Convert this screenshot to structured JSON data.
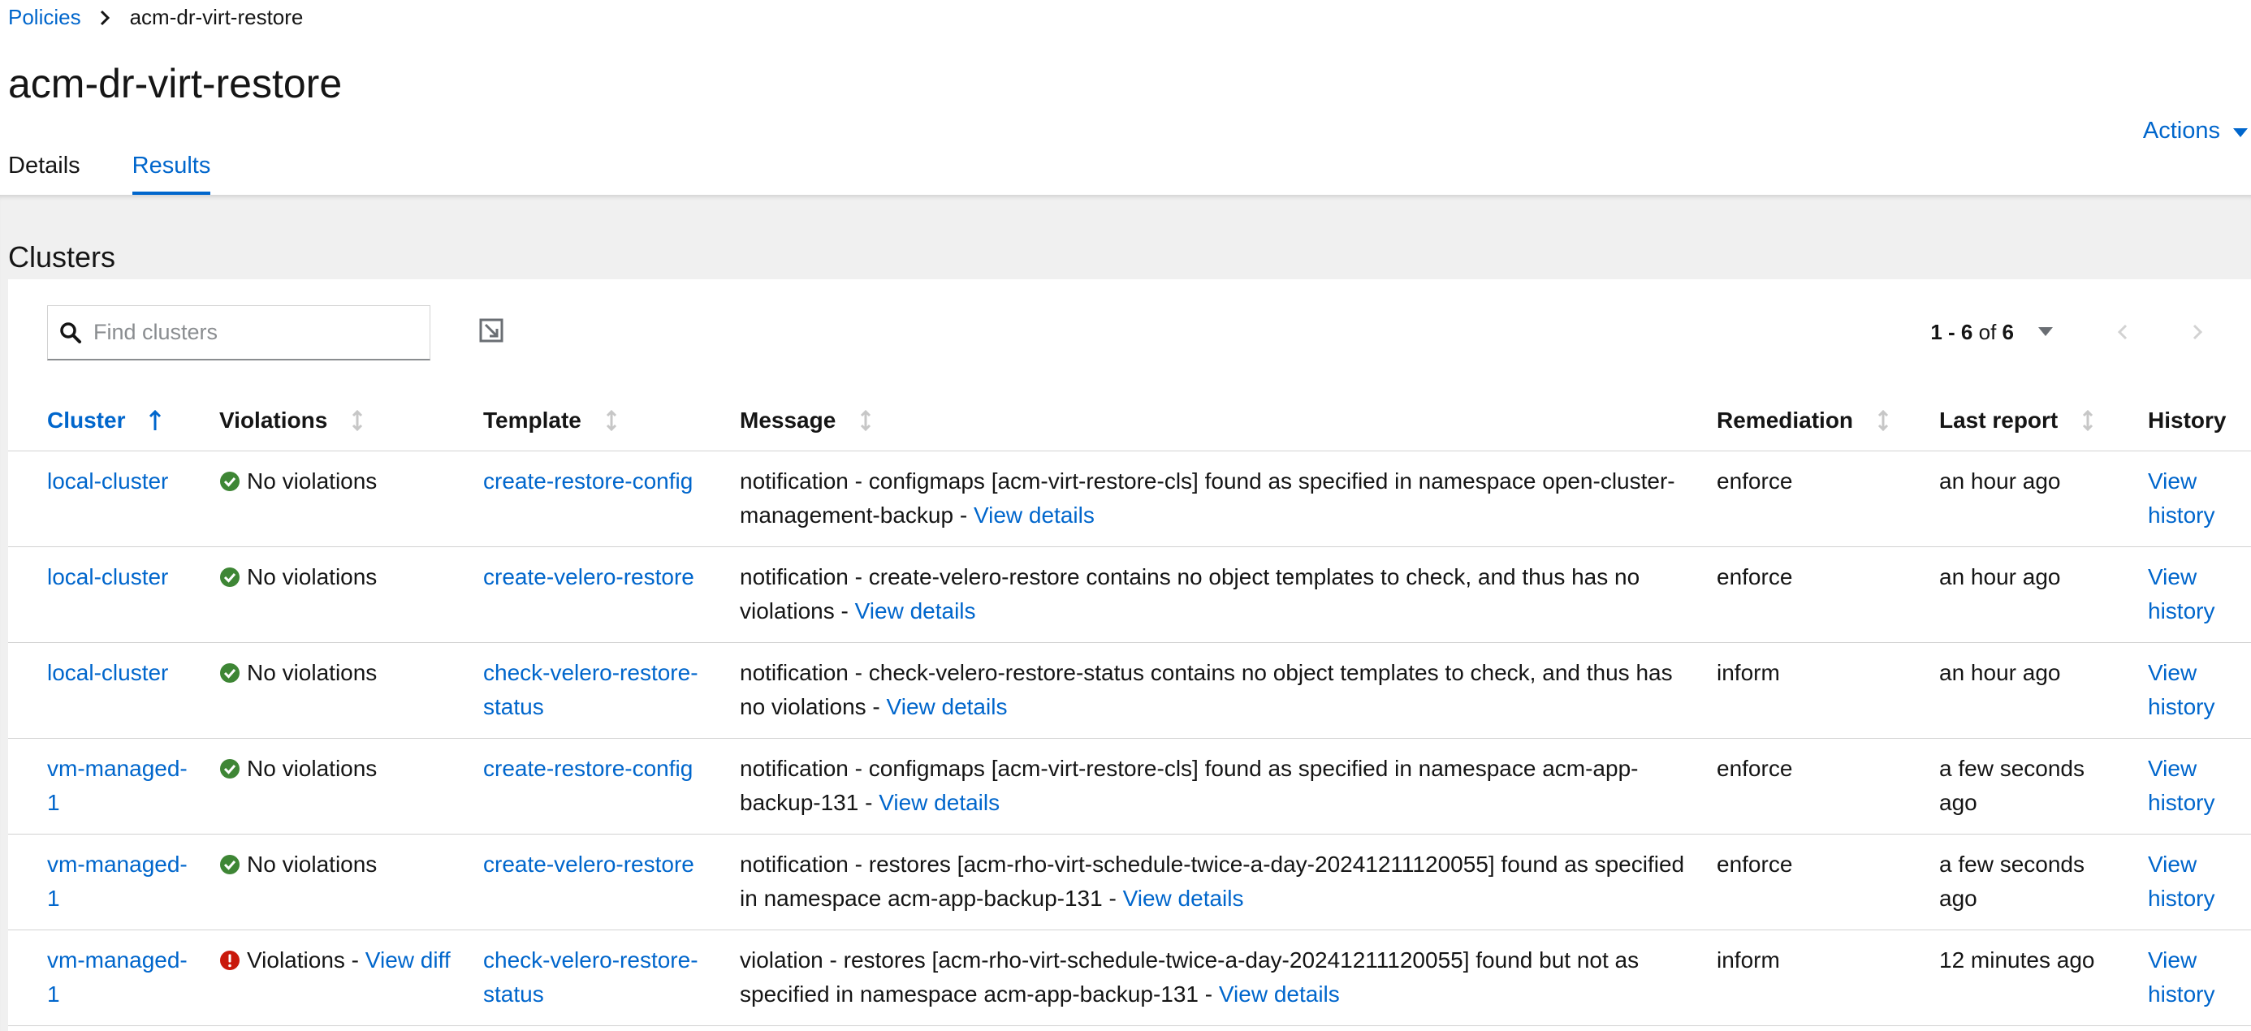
{
  "breadcrumb": {
    "parent": "Policies",
    "current": "acm-dr-virt-restore"
  },
  "page": {
    "title": "acm-dr-virt-restore",
    "actions_label": "Actions"
  },
  "tabs": [
    {
      "label": "Details",
      "active": false
    },
    {
      "label": "Results",
      "active": true
    }
  ],
  "section": {
    "title": "Clusters"
  },
  "search": {
    "placeholder": "Find clusters",
    "value": ""
  },
  "pagination": {
    "range": "1 - 6",
    "of_label": "of",
    "total": "6"
  },
  "columns": {
    "cluster": "Cluster",
    "violations": "Violations",
    "template": "Template",
    "message": "Message",
    "remediation": "Remediation",
    "last_report": "Last report",
    "history": "History"
  },
  "colors": {
    "link": "#0066cc",
    "success": "#3e8635",
    "danger": "#c9190b"
  },
  "rows": [
    {
      "cluster": "local-cluster",
      "status": "success",
      "violations": "No violations",
      "violations_link": "",
      "template": "create-restore-config",
      "message": "notification - configmaps [acm-virt-restore-cls] found as specified in namespace open-cluster-management-backup - ",
      "message_link": "View details",
      "remediation": "enforce",
      "last_report": "an hour ago",
      "history": "View history"
    },
    {
      "cluster": "local-cluster",
      "status": "success",
      "violations": "No violations",
      "violations_link": "",
      "template": "create-velero-restore",
      "message": "notification - create-velero-restore contains no object templates to check, and thus has no violations - ",
      "message_link": "View details",
      "remediation": "enforce",
      "last_report": "an hour ago",
      "history": "View history"
    },
    {
      "cluster": "local-cluster",
      "status": "success",
      "violations": "No violations",
      "violations_link": "",
      "template": "check-velero-restore-status",
      "message": "notification - check-velero-restore-status contains no object templates to check, and thus has no violations - ",
      "message_link": "View details",
      "remediation": "inform",
      "last_report": "an hour ago",
      "history": "View history"
    },
    {
      "cluster": "vm-managed-1",
      "status": "success",
      "violations": "No violations",
      "violations_link": "",
      "template": "create-restore-config",
      "message": "notification - configmaps [acm-virt-restore-cls] found as specified in namespace acm-app-backup-131 - ",
      "message_link": "View details",
      "remediation": "enforce",
      "last_report": "a few seconds ago",
      "history": "View history"
    },
    {
      "cluster": "vm-managed-1",
      "status": "success",
      "violations": "No violations",
      "violations_link": "",
      "template": "create-velero-restore",
      "message": "notification - restores [acm-rho-virt-schedule-twice-a-day-20241211120055] found as specified in namespace acm-app-backup-131 - ",
      "message_link": "View details",
      "remediation": "enforce",
      "last_report": "a few seconds ago",
      "history": "View history"
    },
    {
      "cluster": "vm-managed-1",
      "status": "danger",
      "violations": "Violations - ",
      "violations_link": "View diff",
      "template": "check-velero-restore-status",
      "message": "violation - restores [acm-rho-virt-schedule-twice-a-day-20241211120055] found but not as specified in namespace acm-app-backup-131 - ",
      "message_link": "View details",
      "remediation": "inform",
      "last_report": "12 minutes ago",
      "history": "View history"
    }
  ]
}
